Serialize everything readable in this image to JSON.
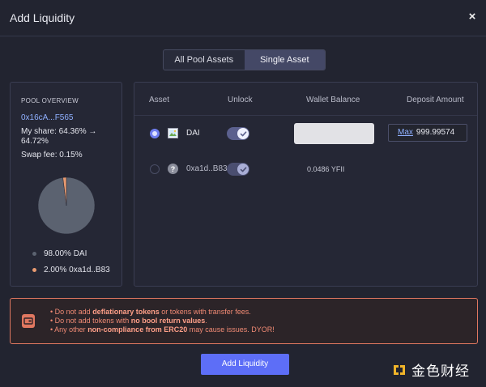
{
  "modal": {
    "title": "Add Liquidity",
    "close_glyph": "×"
  },
  "tabs": [
    {
      "label": "All Pool Assets",
      "active": false
    },
    {
      "label": "Single Asset",
      "active": true
    }
  ],
  "pool_overview": {
    "heading": "POOL OVERVIEW",
    "address": "0x16cA...F565",
    "my_share": "My share: 64.36% → 64.72%",
    "swap_fee": "Swap fee: 0.15%",
    "legend": [
      {
        "label": "98.00% DAI",
        "color": "#5b6270"
      },
      {
        "label": "2.00% 0xa1d..B83",
        "color": "#e89a70"
      }
    ]
  },
  "chart_data": {
    "type": "pie",
    "slices": [
      {
        "label": "DAI",
        "value": 98.0,
        "color": "#5b6270"
      },
      {
        "label": "0xa1d..B83",
        "value": 2.0,
        "color": "#e89a70"
      }
    ]
  },
  "assets_table": {
    "columns": [
      "Asset",
      "Unlock",
      "Wallet Balance",
      "Deposit Amount"
    ],
    "rows": [
      {
        "selected": true,
        "asset": "DAI",
        "icon": "broken-image-icon",
        "unlocked": true,
        "wallet_balance": "",
        "max_label": "Max",
        "deposit_amount": "999.99574"
      },
      {
        "selected": false,
        "asset": "0xa1d..B83",
        "icon": "unknown-token-icon",
        "unknown_glyph": "?",
        "unlocked": true,
        "wallet_balance": "0.0486 YFII"
      }
    ]
  },
  "warning": {
    "lines": [
      {
        "pre": "• Do not add ",
        "bold": "deflationary tokens",
        "post": " or tokens with transfer fees."
      },
      {
        "pre": "• Do not add tokens with ",
        "bold": "no bool return values",
        "post": "."
      },
      {
        "pre": "• Any other ",
        "bold": "non-compliance from ERC20",
        "post": " may cause issues. DYOR!"
      }
    ],
    "accent_color": "#e07760"
  },
  "primary_button": {
    "label": "Add Liquidity",
    "color": "#5d6ef7"
  },
  "watermark": {
    "text": "金色财经"
  }
}
